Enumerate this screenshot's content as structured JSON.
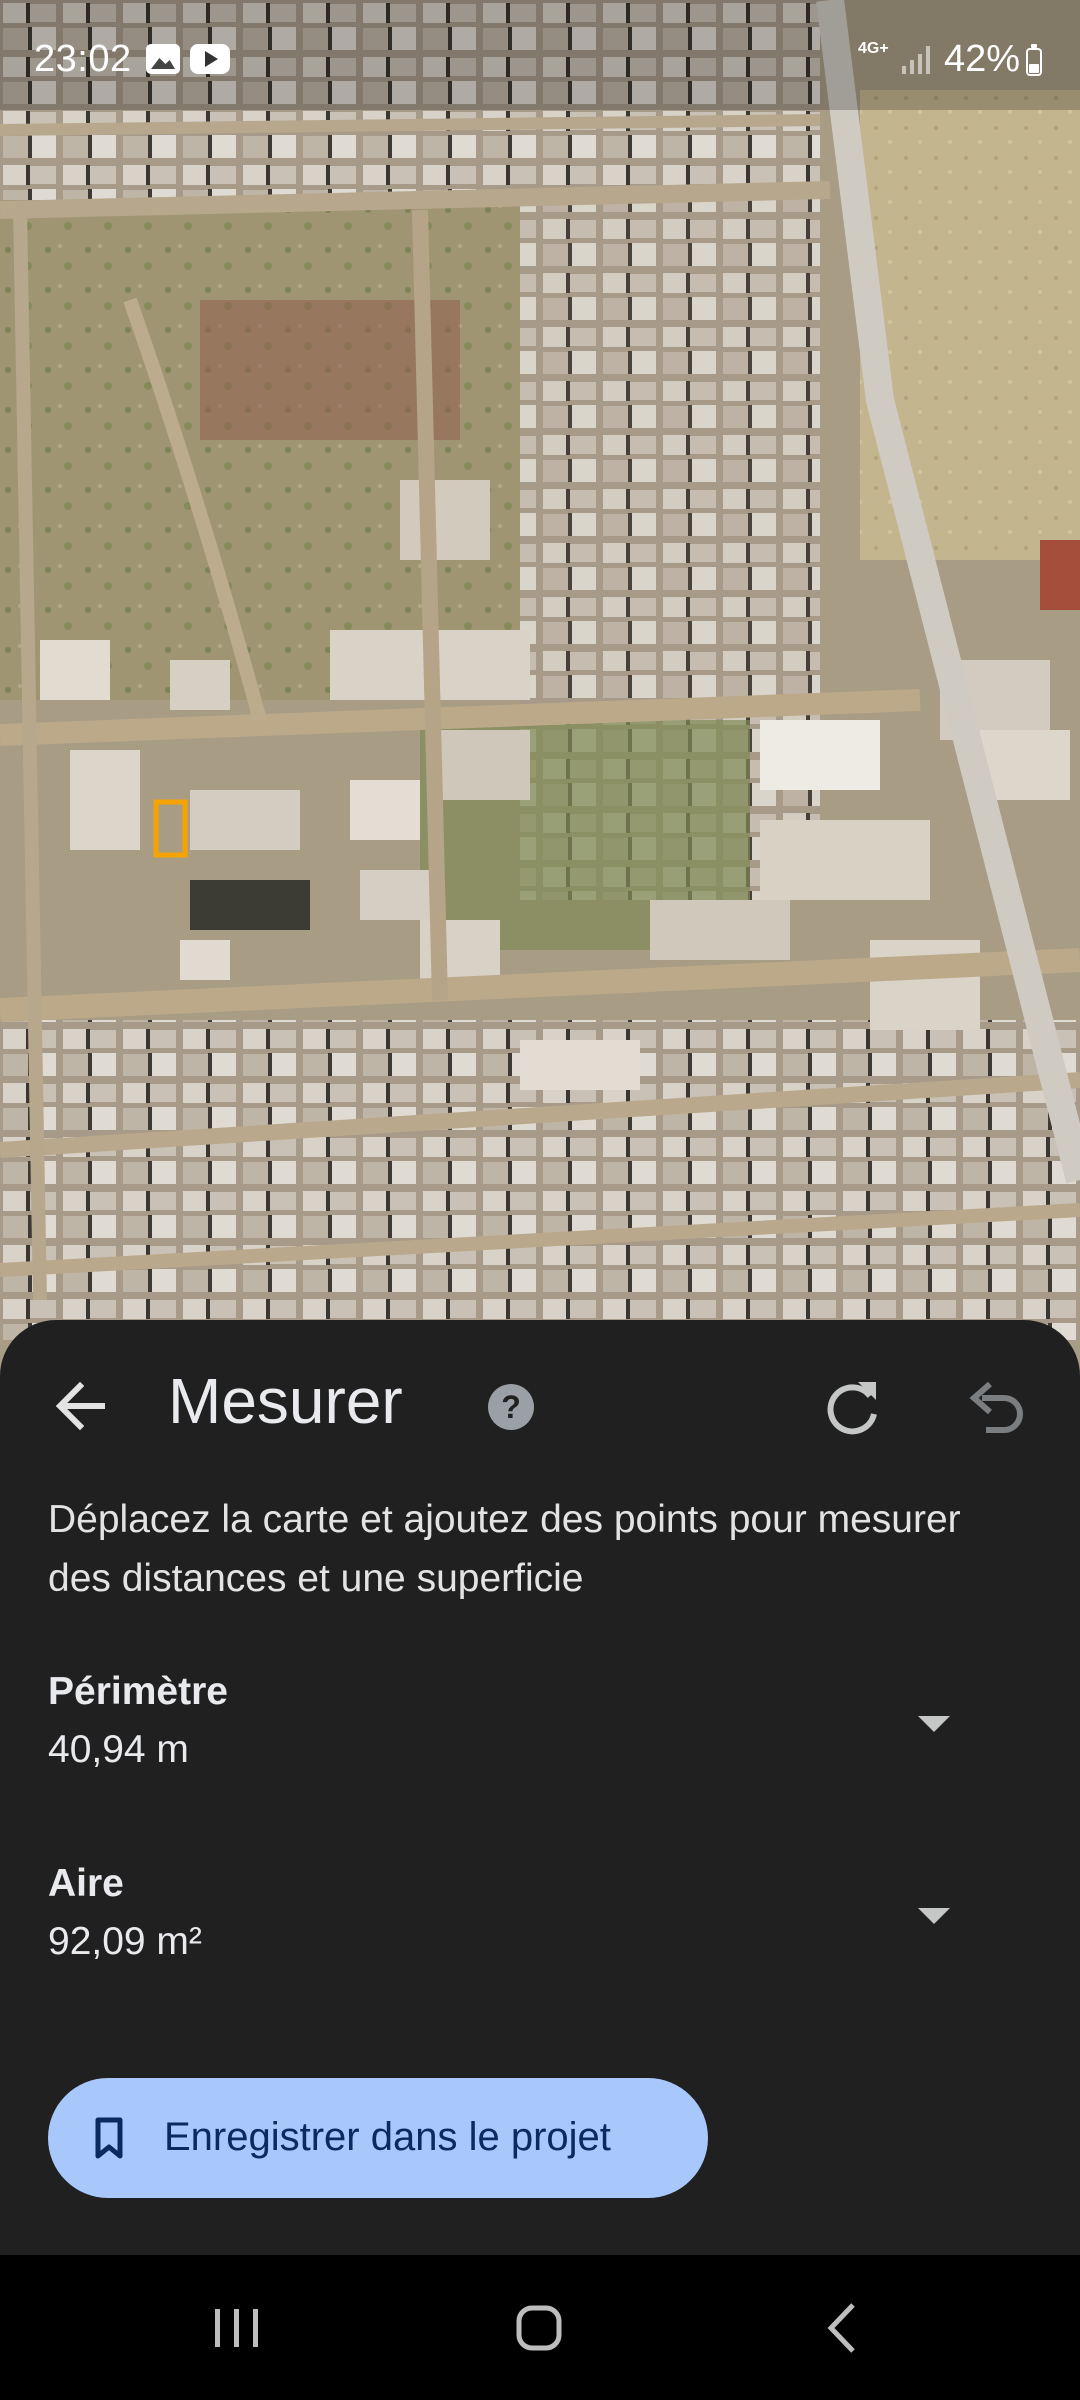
{
  "status_bar": {
    "time": "23:02",
    "notification_icons": [
      "gallery-icon",
      "youtube-icon"
    ],
    "network": "4G+",
    "battery": "42%",
    "battery_level": 0.42
  },
  "map": {
    "view": "satellite",
    "highlight_color": "#f5a300"
  },
  "measure_panel": {
    "title": "Mesurer",
    "help_icon_glyph": "?",
    "instructions": "Déplacez la carte et ajoutez des points pour mesurer des distances et une superficie",
    "perimeter": {
      "label": "Périmètre",
      "value": "40,94 m"
    },
    "area": {
      "label": "Aire",
      "value": "92,09 m²"
    },
    "save_button_label": "Enregistrer dans le projet",
    "colors": {
      "sheet_background": "#202020",
      "save_button": "#a8c7fa"
    }
  },
  "nav_bar": {
    "buttons": [
      "recents-icon",
      "home-icon",
      "back-icon"
    ]
  }
}
